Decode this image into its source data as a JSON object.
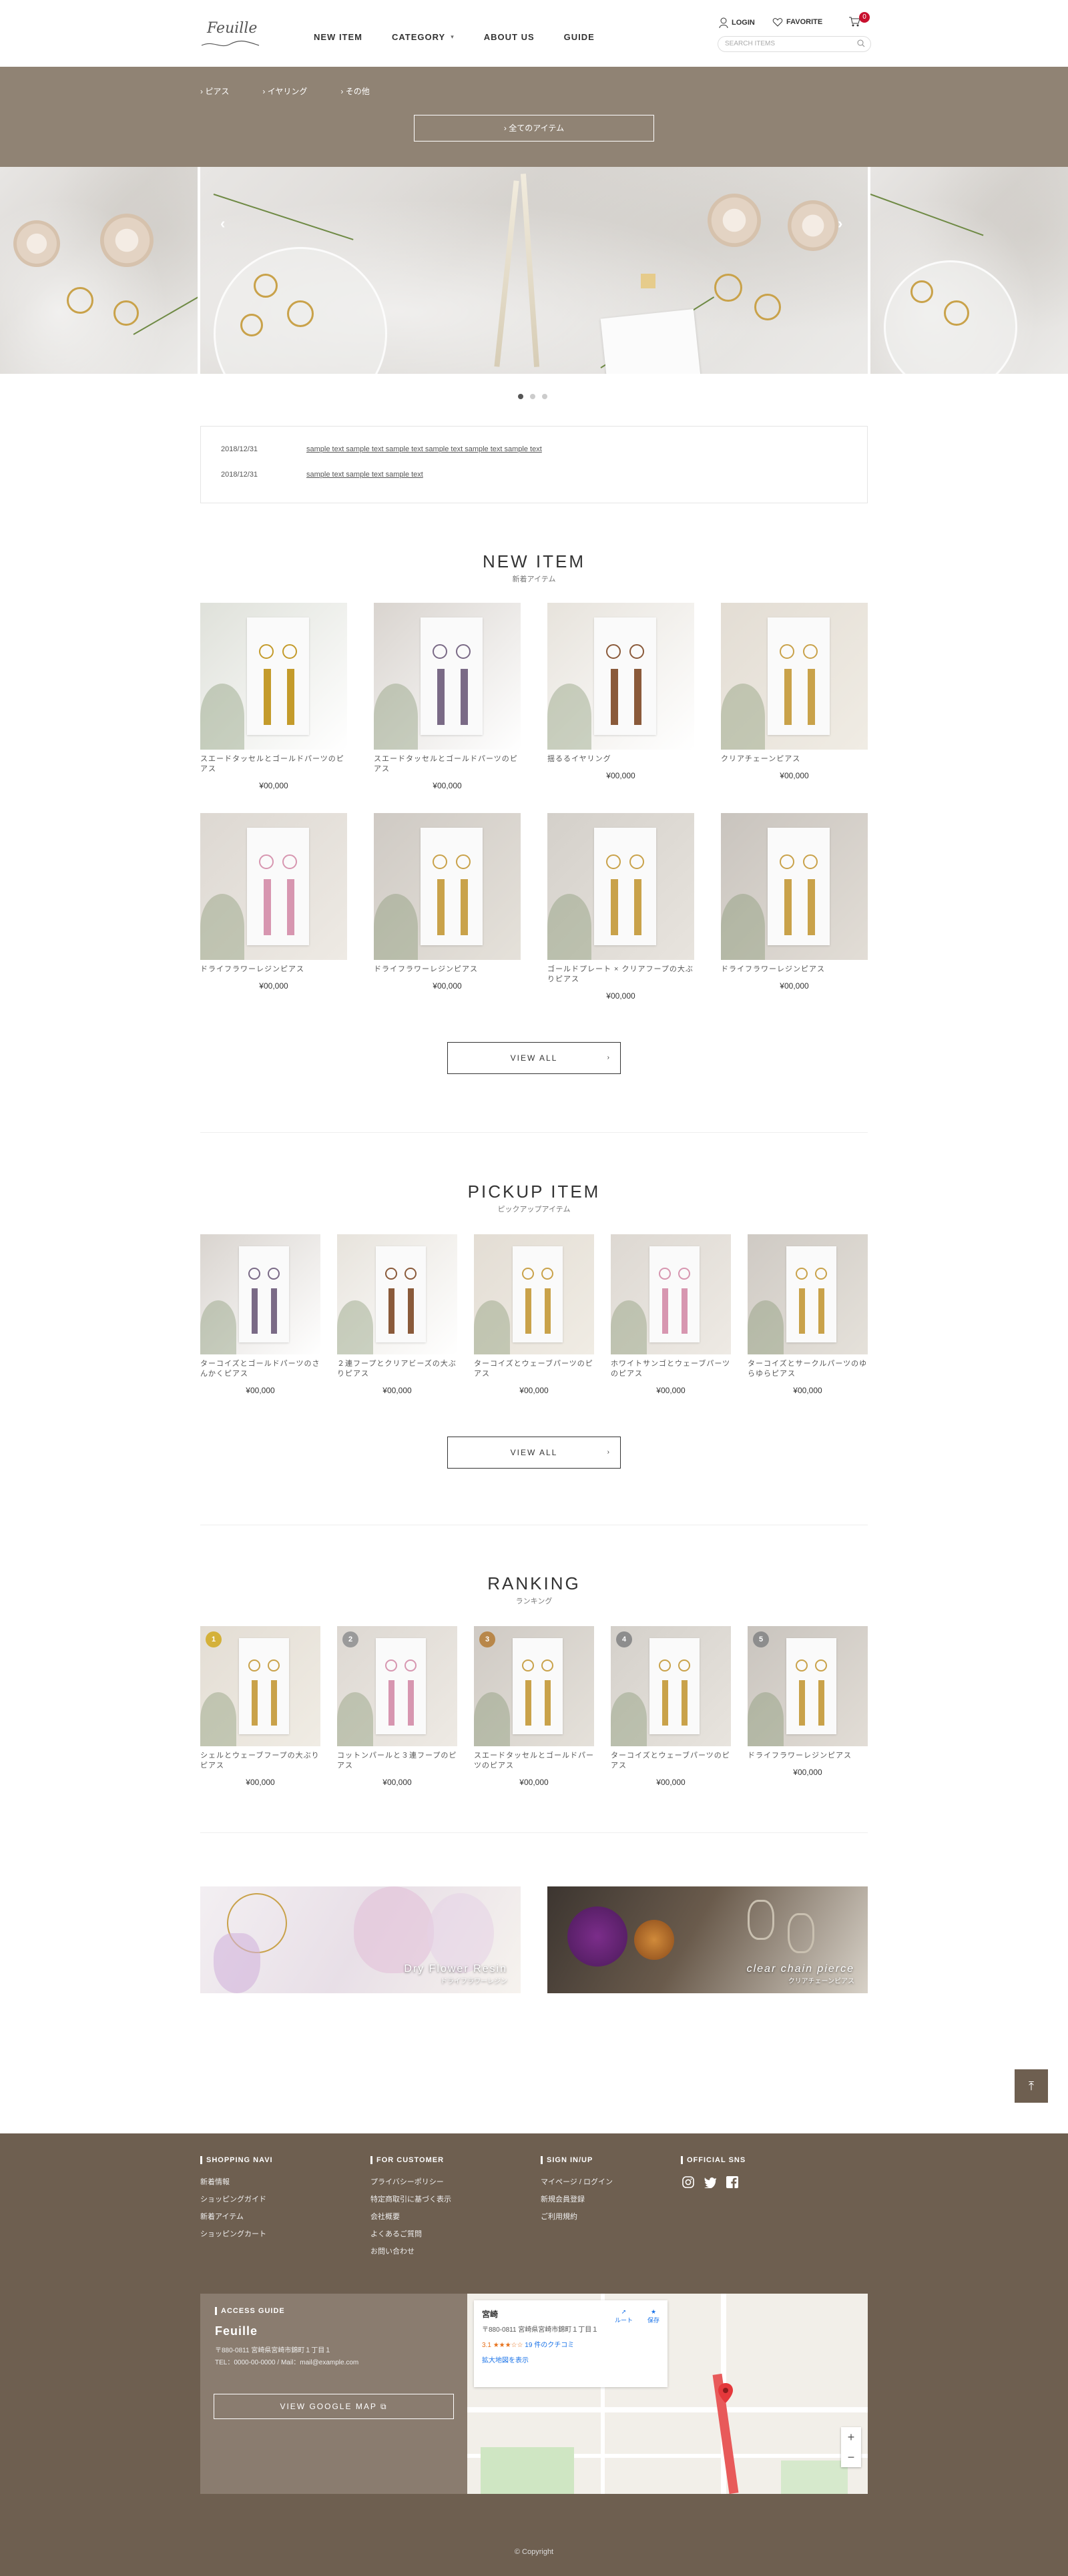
{
  "header": {
    "logo": "Feuille",
    "nav": [
      {
        "label": "NEW ITEM"
      },
      {
        "label": "CATEGORY"
      },
      {
        "label": "ABOUT US"
      },
      {
        "label": "GUIDE"
      }
    ],
    "login_label": "LOGIN",
    "favorite_label": "FAVORITE",
    "cart_count": "0",
    "search_placeholder": "SEARCH ITEMS"
  },
  "category_menu": {
    "links": [
      "ピアス",
      "イヤリング",
      "その他"
    ],
    "all_items_label": "全てのアイテム"
  },
  "slider": {
    "dots": 3,
    "active": 0
  },
  "news": [
    {
      "date": "2018/12/31",
      "title": "sample text sample text sample text sample text sample text sample text"
    },
    {
      "date": "2018/12/31",
      "title": "sample text sample text sample text"
    }
  ],
  "new_item": {
    "title_en": "NEW ITEM",
    "title_ja": "新着アイテム",
    "items": [
      {
        "name": "スエードタッセルとゴールドパーツのピアス",
        "price": "¥00,000"
      },
      {
        "name": "スエードタッセルとゴールドパーツのピアス",
        "price": "¥00,000"
      },
      {
        "name": "揺るるイヤリング",
        "price": "¥00,000"
      },
      {
        "name": "クリアチェーンピアス",
        "price": "¥00,000"
      },
      {
        "name": "ドライフラワーレジンピアス",
        "price": "¥00,000"
      },
      {
        "name": "ドライフラワーレジンピアス",
        "price": "¥00,000"
      },
      {
        "name": "ゴールドプレート × クリアフープの大ぶりピアス",
        "price": "¥00,000"
      },
      {
        "name": "ドライフラワーレジンピアス",
        "price": "¥00,000"
      }
    ],
    "view_all": "VIEW ALL"
  },
  "pickup_item": {
    "title_en": "PICKUP ITEM",
    "title_ja": "ピックアップアイテム",
    "items": [
      {
        "name": "ターコイズとゴールドパーツのさんかくピアス",
        "price": "¥00,000"
      },
      {
        "name": "２連フープとクリアビーズの大ぶりピアス",
        "price": "¥00,000"
      },
      {
        "name": "ターコイズとウェーブパーツのピアス",
        "price": "¥00,000"
      },
      {
        "name": "ホワイトサンゴとウェーブパーツのピアス",
        "price": "¥00,000"
      },
      {
        "name": "ターコイズとサークルパーツのゆらゆらピアス",
        "price": "¥00,000"
      }
    ],
    "view_all": "VIEW ALL"
  },
  "ranking": {
    "title_en": "RANKING",
    "title_ja": "ランキング",
    "items": [
      {
        "rank": "1",
        "name": "シェルとウェーブフープの大ぶりピアス",
        "price": "¥00,000",
        "color": "#d4b13a"
      },
      {
        "rank": "2",
        "name": "コットンパールと３連フープのピアス",
        "price": "¥00,000",
        "color": "#9a9a9a"
      },
      {
        "rank": "3",
        "name": "スエードタッセルとゴールドパーツのピアス",
        "price": "¥00,000",
        "color": "#b8874a"
      },
      {
        "rank": "4",
        "name": "ターコイズとウェーブパーツのピアス",
        "price": "¥00,000",
        "color": "#8d8d8d"
      },
      {
        "rank": "5",
        "name": "ドライフラワーレジンピアス",
        "price": "¥00,000",
        "color": "#8d8d8d"
      }
    ]
  },
  "banners": [
    {
      "en": "Dry Flower Resin",
      "ja": "ドライフラワーレジン"
    },
    {
      "en": "clear chain pierce",
      "ja": "クリアチェーンピアス"
    }
  ],
  "footer": {
    "shopping_navi": {
      "title": "SHOPPING NAVI",
      "items": [
        "新着情報",
        "ショッピングガイド",
        "新着アイテム",
        "ショッピングカート"
      ]
    },
    "for_customer": {
      "title": "FOR CUSTOMER",
      "items": [
        "プライバシーポリシー",
        "特定商取引に基づく表示",
        "会社概要",
        "よくあるご質問",
        "お問い合わせ"
      ]
    },
    "sign_in": {
      "title": "SIGN IN/UP",
      "items": [
        "マイページ / ログイン",
        "新規会員登録",
        "ご利用規約"
      ]
    },
    "official_sns": {
      "title": "OFFICIAL SNS"
    },
    "access": {
      "title": "ACCESS GUIDE",
      "name": "Feuille",
      "address": "〒880-0811 宮崎県宮崎市錦町１丁目１",
      "contact": "TEL：0000-00-0000 / Mail：mail@example.com",
      "map_button": "VIEW GOOGLE MAP"
    },
    "map": {
      "place": "宮崎",
      "address": "〒880-0811 宮崎県宮崎市錦町１丁目１",
      "rating": "3.1",
      "reviews": "19 件のクチコミ",
      "enlarge": "拡大地図を表示",
      "route": "ルート",
      "save": "保存"
    },
    "copyright": "© Copyright"
  }
}
